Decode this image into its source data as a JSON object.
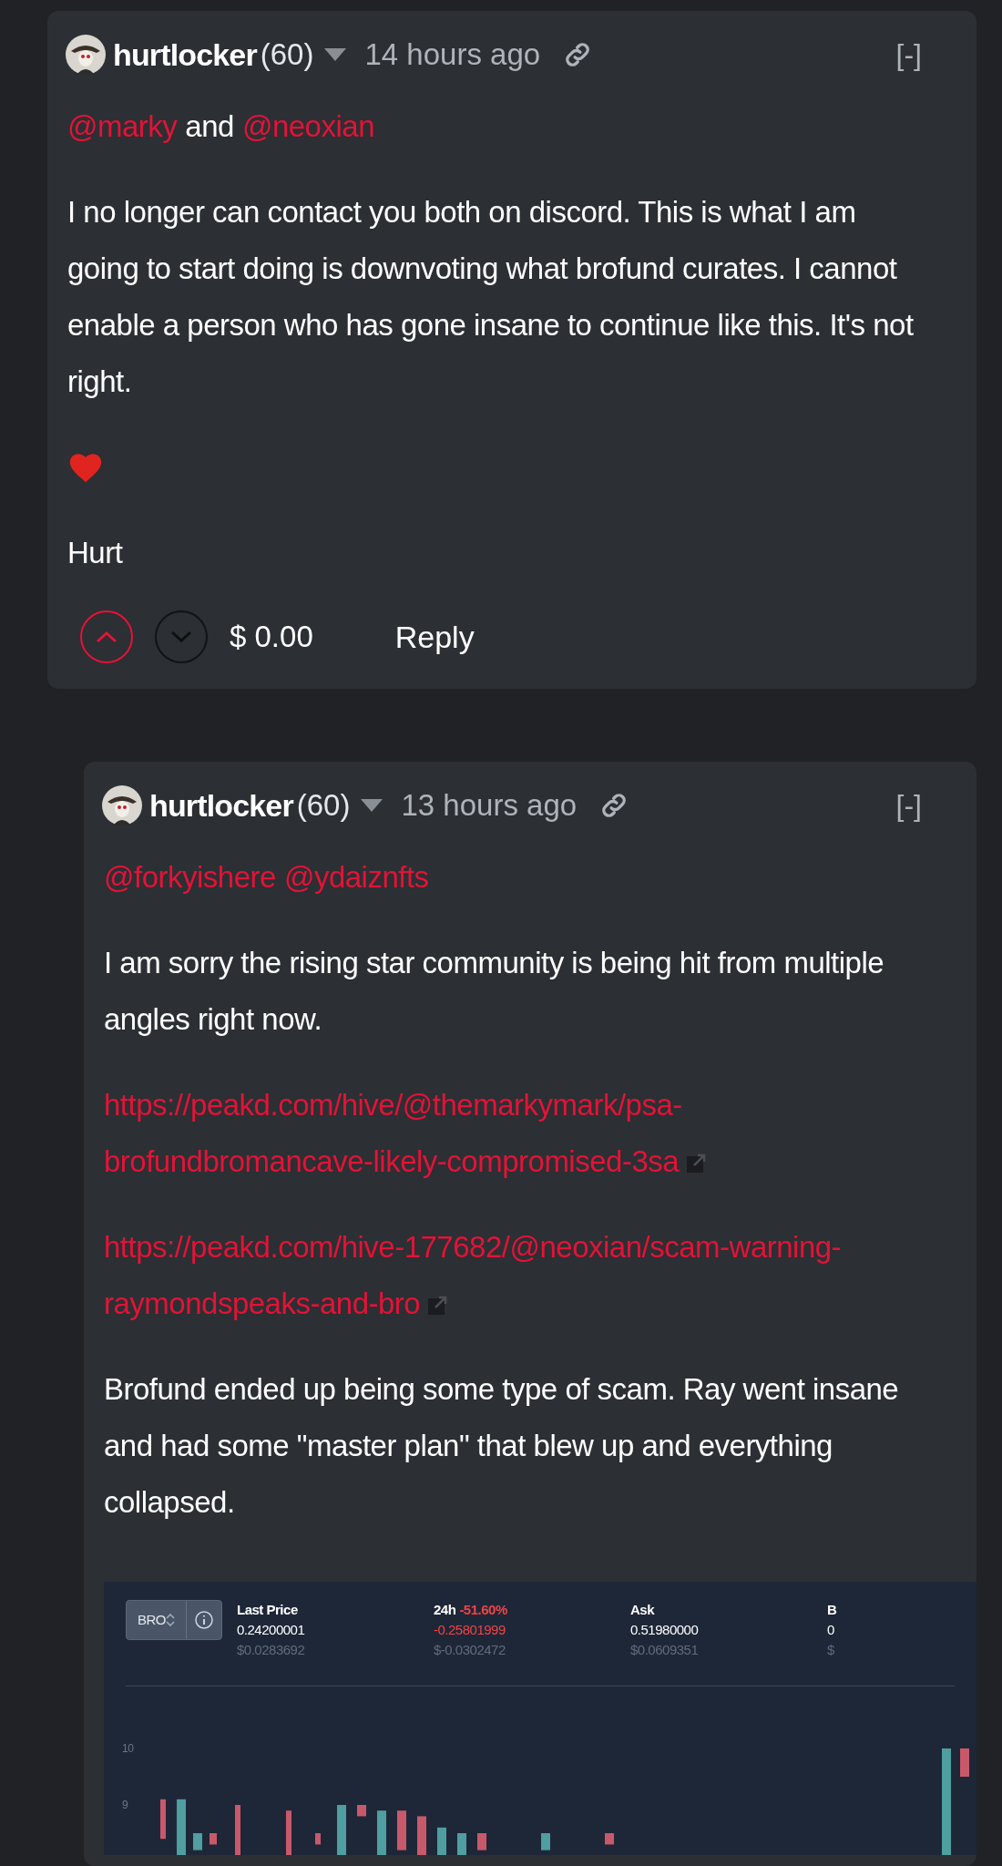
{
  "comments": [
    {
      "author": "hurtlocker",
      "reputation": "(60)",
      "time": "14 hours ago",
      "collapse": "[-]",
      "kind": "comment",
      "body": [
        {
          "kind": "mentions",
          "parts": [
            {
              "text": "@marky",
              "kind": "mention"
            },
            {
              "text": "and",
              "kind": "word"
            },
            {
              "text": "@neoxian",
              "kind": "mention"
            }
          ]
        },
        {
          "kind": "text",
          "text": "I no longer can contact you both on discord. This is what I am going to start doing is downvoting what brofund curates. I cannot enable a person who has gone insane to continue like this. It's not right."
        },
        {
          "kind": "heart"
        },
        {
          "kind": "text",
          "text": "Hurt"
        }
      ],
      "footer": {
        "payout": "$ 0.00",
        "reply": "Reply"
      }
    },
    {
      "author": "hurtlocker",
      "reputation": "(60)",
      "time": "13 hours ago",
      "collapse": "[-]",
      "kind": "reply",
      "body": [
        {
          "kind": "mentions",
          "parts": [
            {
              "text": "@forkyishere",
              "kind": "mention"
            },
            {
              "text": "@ydaiznfts",
              "kind": "mention"
            }
          ]
        },
        {
          "kind": "text",
          "text": "I am sorry the rising star community is being hit from multiple angles right now."
        },
        {
          "kind": "link",
          "text": "https://peakd.com/hive/@themarkymark/psa-brofundbromancave-likely-compromised-3sa"
        },
        {
          "kind": "link",
          "text": "https://peakd.com/hive-177682/@neoxian/scam-warning-raymondspeaks-and-bro"
        },
        {
          "kind": "text",
          "text": "Brofund ended up being some type of scam. Ray went insane and had some \"master plan\" that blew up and everything collapsed."
        },
        {
          "kind": "screenshot",
          "token": "BRO",
          "stats": [
            {
              "label": "Last Price",
              "value": "0.24200001",
              "usd": "$0.0283692",
              "negative": false
            },
            {
              "label": "24h",
              "change": "-51.60%",
              "value": "-0.25801999",
              "usd": "$-0.0302472",
              "negative": true
            },
            {
              "label": "Ask",
              "value": "0.51980000",
              "usd": "$0.0609351",
              "negative": false
            },
            {
              "label": "B",
              "value": "0",
              "usd": "$",
              "negative": false
            }
          ],
          "y_labels": [
            "10",
            "9"
          ]
        }
      ]
    }
  ]
}
